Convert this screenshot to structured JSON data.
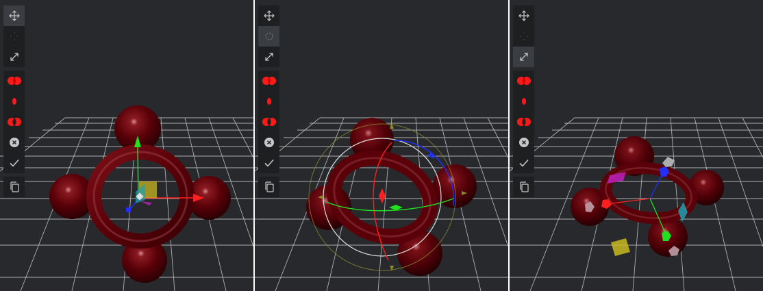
{
  "panels": [
    {
      "id": "translate",
      "active_tool": "move"
    },
    {
      "id": "rotate",
      "active_tool": "rotate"
    },
    {
      "id": "scale",
      "active_tool": "scale"
    }
  ],
  "toolbar": {
    "transform_tools": [
      {
        "icon": "move-arrows-icon"
      },
      {
        "icon": "rotate-icon"
      },
      {
        "icon": "scale-arrows-icon"
      }
    ],
    "action_tools": [
      {
        "icon": "union-icon"
      },
      {
        "icon": "intersect-icon"
      },
      {
        "icon": "subtract-icon"
      },
      {
        "icon": "cancel-icon"
      },
      {
        "icon": "confirm-check-icon"
      }
    ],
    "extra_tools": [
      {
        "icon": "copy-icon"
      }
    ]
  },
  "colors": {
    "viewport_bg": "#27292c",
    "toolbar_bg": "#1d1f21",
    "active_tool_bg": "#3a3d41",
    "icon_gray": "#c8c8c8",
    "boolean_red": "#ff1a1a",
    "object_maroon": "#5a0008",
    "axis_x": "#ff2020",
    "axis_y": "#20e020",
    "axis_z": "#2030ff"
  }
}
